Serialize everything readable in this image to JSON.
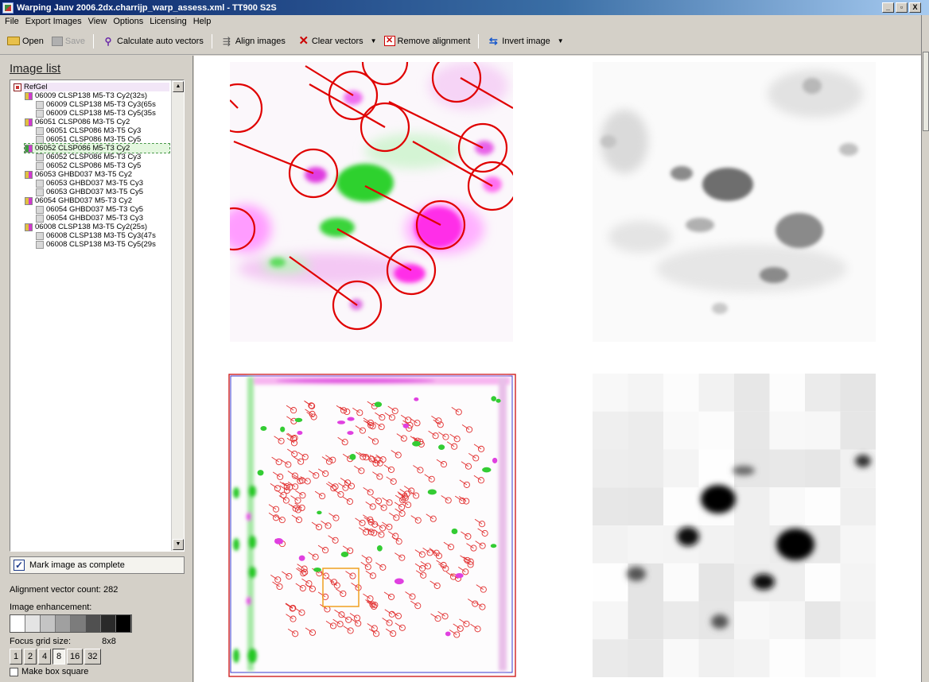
{
  "window": {
    "title": "Warping Janv 2006.2dx.charrijp_warp_assess.xml - TT900 S2S",
    "controls": [
      "_",
      "▫",
      "X"
    ]
  },
  "menu": [
    "File",
    "Export Images",
    "View",
    "Options",
    "Licensing",
    "Help"
  ],
  "toolbar": {
    "open": "Open",
    "save": "Save",
    "calculate": "Calculate auto vectors",
    "align": "Align images",
    "clear": "Clear vectors",
    "remove": "Remove alignment",
    "invert": "Invert image"
  },
  "left_panel": {
    "title": "Image list",
    "tree": [
      {
        "label": "RefGel",
        "level": 0,
        "icon": "root"
      },
      {
        "label": "06009 CLSP138 M5-T3 Cy2(32s)",
        "level": 1,
        "icon": "pair"
      },
      {
        "label": "06009 CLSP138 M5-T3 Cy3(65s",
        "level": 2,
        "icon": "leaf"
      },
      {
        "label": "06009 CLSP138 M5-T3 Cy5(35s",
        "level": 2,
        "icon": "leaf"
      },
      {
        "label": "06051 CLSP086 M3-T5 Cy2",
        "level": 1,
        "icon": "pair"
      },
      {
        "label": "06051 CLSP086 M3-T5 Cy3",
        "level": 2,
        "icon": "leaf"
      },
      {
        "label": "06051 CLSP086 M3-T5 Cy5",
        "level": 2,
        "icon": "leaf"
      },
      {
        "label": "06052 CLSP086 M5-T3 Cy2",
        "level": 1,
        "icon": "gel",
        "selected": true
      },
      {
        "label": "06052 CLSP086 M5-T3 Cy3",
        "level": 2,
        "icon": "leaf"
      },
      {
        "label": "06052 CLSP086 M5-T3 Cy5",
        "level": 2,
        "icon": "leaf"
      },
      {
        "label": "06053 GHBD037 M3-T5 Cy2",
        "level": 1,
        "icon": "pair"
      },
      {
        "label": "06053 GHBD037 M3-T5 Cy3",
        "level": 2,
        "icon": "leaf"
      },
      {
        "label": "06053 GHBD037 M3-T5 Cy5",
        "level": 2,
        "icon": "leaf"
      },
      {
        "label": "06054 GHBD037 M5-T3 Cy2",
        "level": 1,
        "icon": "pair"
      },
      {
        "label": "06054 GHBD037 M5-T3 Cy5",
        "level": 2,
        "icon": "leaf"
      },
      {
        "label": "06054 GHBD037 M5-T3 Cy3",
        "level": 2,
        "icon": "leaf"
      },
      {
        "label": "06008 CLSP138 M3-T5 Cy2(25s)",
        "level": 1,
        "icon": "pair"
      },
      {
        "label": "06008 CLSP138 M3-T5 Cy3(47s",
        "level": 2,
        "icon": "leaf"
      },
      {
        "label": "06008 CLSP138 M3-T5 Cy5(29s",
        "level": 2,
        "icon": "leaf"
      }
    ],
    "mark_complete": "Mark image as complete",
    "vector_count_label": "Alignment vector count:",
    "vector_count": "282",
    "enhancement_label": "Image enhancement:",
    "enhancement_levels": [
      "#ffffff",
      "#e4e4e4",
      "#c4c4c4",
      "#a0a0a0",
      "#7c7c7c",
      "#505050",
      "#2a2a2a",
      "#000000"
    ],
    "grid_label": "Focus grid size:",
    "grid_value": "8x8",
    "grid_sizes": [
      "1",
      "2",
      "4",
      "8",
      "16",
      "32"
    ],
    "grid_active": "8",
    "square_label": "Make box square"
  }
}
